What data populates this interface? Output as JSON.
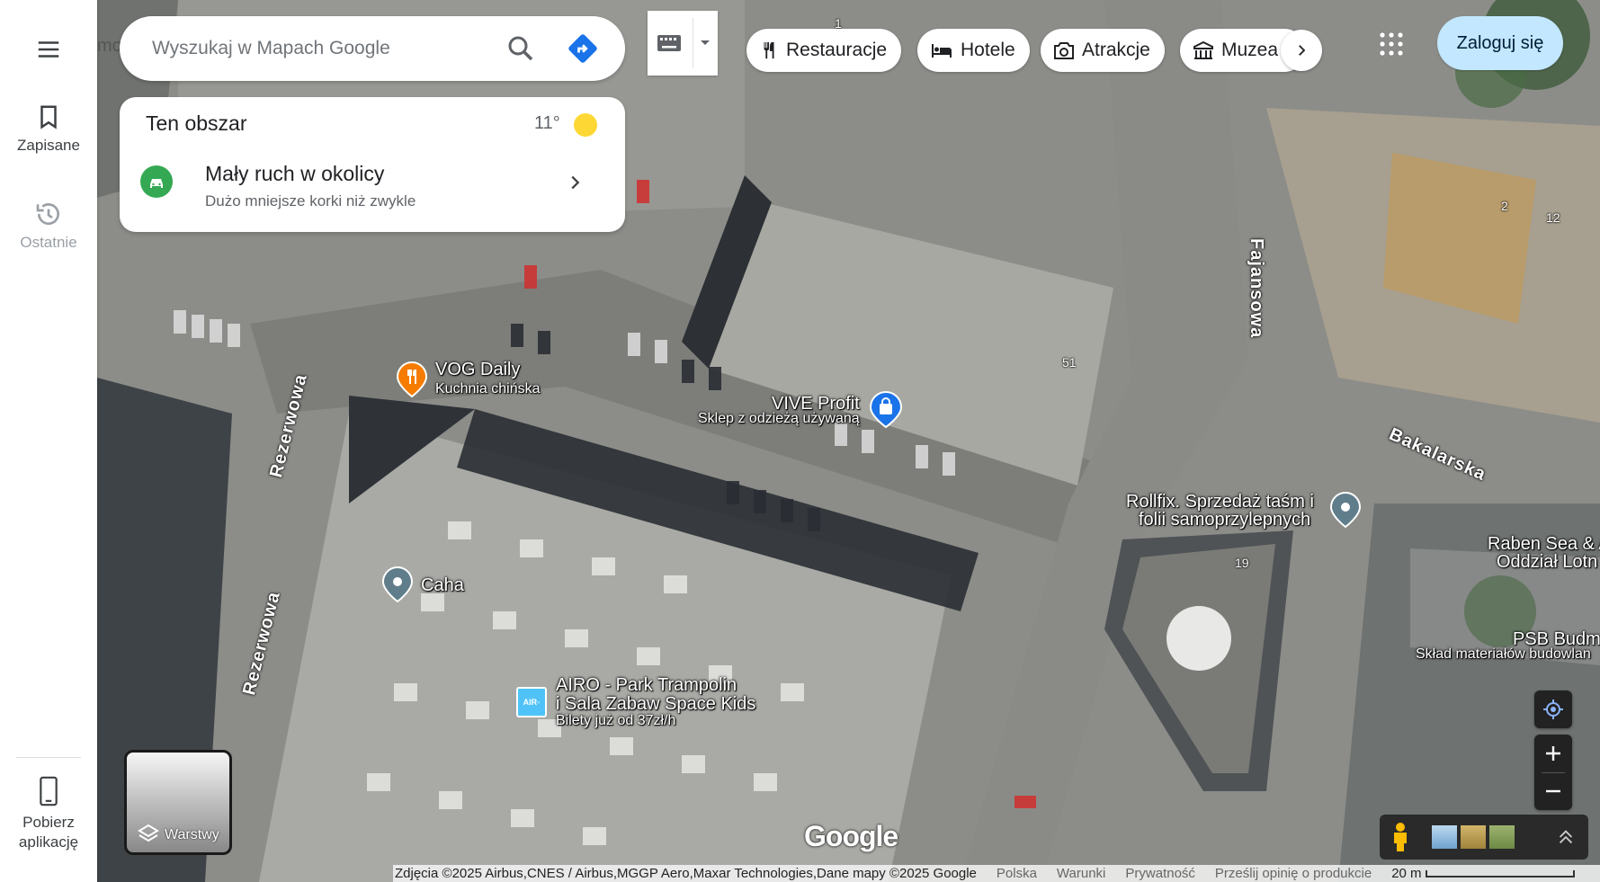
{
  "rail": {
    "saved_label": "Zapisane",
    "recent_label": "Ostatnie",
    "download_label_1": "Pobierz",
    "download_label_2": "aplikację"
  },
  "search": {
    "placeholder": "Wyszukaj w Mapach Google"
  },
  "chips": [
    {
      "label": "Restauracje",
      "icon": "fork-knife-icon"
    },
    {
      "label": "Hotele",
      "icon": "bed-icon"
    },
    {
      "label": "Atrakcje",
      "icon": "camera-icon"
    },
    {
      "label": "Muzea",
      "icon": "museum-icon"
    }
  ],
  "login_label": "Zaloguj się",
  "area_card": {
    "title": "Ten obszar",
    "temperature": "11°",
    "traffic_title": "Mały ruch w okolicy",
    "traffic_subtitle": "Dużo mniejsze korki niż zwykle"
  },
  "places": {
    "vog_name": "VOG Daily",
    "vog_sub": "Kuchnia chińska",
    "vive_name": "VIVE Profit",
    "vive_sub": "Sklep z odzieżą używaną",
    "rollfix_1": "Rollfix. Sprzedaż taśm i",
    "rollfix_2": "folii samoprzylepnych",
    "caha": "Caha",
    "airo_1": "AIRO - Park Trampolin",
    "airo_2": "i Sala Zabaw Space Kids",
    "airo_3": "Bilety już od 37zł/h",
    "raben_1": "Raben Sea & A",
    "raben_2": "Oddział Lotn",
    "psb_1": "PSB Budm",
    "psb_2": "Skład materiałów budowlan",
    "partial_left": "mo"
  },
  "streets": {
    "rezerwowa": "Rezerwowa",
    "fajansowa": "Fajansowa",
    "bakalarska": "Bakalarska"
  },
  "house_numbers": [
    "1",
    "51",
    "2",
    "12",
    "19"
  ],
  "layers_label": "Warstwy",
  "logo": "Google",
  "footer": {
    "imagery": "Zdjęcia ©2025 Airbus,CNES / Airbus,MGGP Aero,Maxar Technologies,Dane mapy ©2025 Google",
    "country": "Polska",
    "terms": "Warunki",
    "privacy": "Prywatność",
    "feedback": "Prześlij opinię o produkcie",
    "scale": "20 m"
  },
  "colors": {
    "accent_blue": "#1a73e8",
    "login_bg": "#c2e7ff",
    "traffic_green": "#34a853",
    "restaurant_pin": "#f57c00",
    "shopping_pin": "#1a73e8",
    "generic_pin": "#607d8b"
  }
}
